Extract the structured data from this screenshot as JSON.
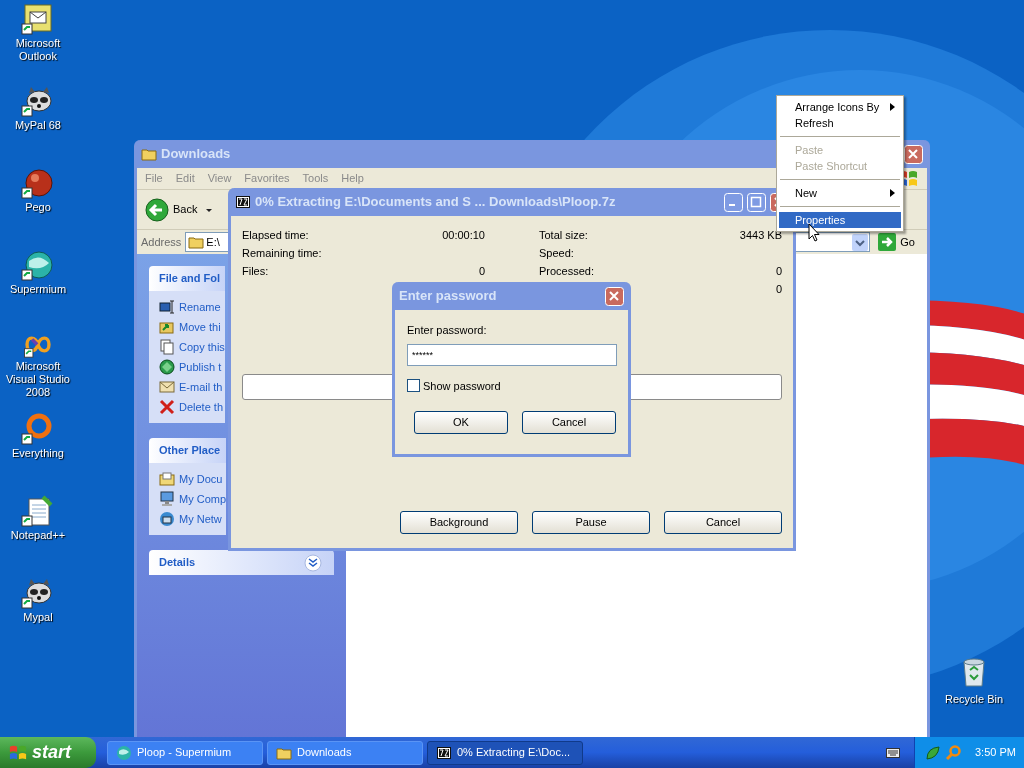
{
  "desktop_icons": [
    {
      "label": "Microsoft Outlook",
      "kind": "outlook"
    },
    {
      "label": "MyPal 68",
      "kind": "raccoon"
    },
    {
      "label": "Pego",
      "kind": "ball"
    },
    {
      "label": "Supermium",
      "kind": "globe"
    },
    {
      "label": "Microsoft Visual Studio 2008",
      "kind": "vs"
    },
    {
      "label": "Everything",
      "kind": "ring"
    },
    {
      "label": "Notepad++",
      "kind": "notepad"
    },
    {
      "label": "Mypal",
      "kind": "raccoon"
    }
  ],
  "recycle_bin": {
    "label": "Recycle Bin"
  },
  "explorer": {
    "title": "Downloads",
    "menu": [
      "File",
      "Edit",
      "View",
      "Favorites",
      "Tools",
      "Help"
    ],
    "back_label": "Back",
    "address_label": "Address",
    "address_value": "E:\\",
    "go_label": "Go",
    "panels": [
      {
        "title": "File and Fol",
        "items": [
          {
            "label": "Rename",
            "kind": "rename"
          },
          {
            "label": "Move thi",
            "kind": "move"
          },
          {
            "label": "Copy this",
            "kind": "copy"
          },
          {
            "label": "Publish t",
            "kind": "publish"
          },
          {
            "label": "E-mail th",
            "kind": "email"
          },
          {
            "label": "Delete th",
            "kind": "delete"
          }
        ]
      },
      {
        "title": "Other Place",
        "items": [
          {
            "label": "My Docu",
            "kind": "documents"
          },
          {
            "label": "My Comp",
            "kind": "computer"
          },
          {
            "label": "My Netw",
            "kind": "network"
          }
        ]
      },
      {
        "title": "Details"
      }
    ]
  },
  "extract_window": {
    "title": "0% Extracting E:\\Documents and S ... Downloads\\Ploop.7z",
    "stats_left": [
      {
        "label": "Elapsed time:",
        "value": "00:00:10"
      },
      {
        "label": "Remaining time:"
      },
      {
        "label": "Files:",
        "value": "0"
      }
    ],
    "stats_right": [
      {
        "label": "Total size:",
        "value": "3443 KB"
      },
      {
        "label": "Speed:"
      },
      {
        "label": "Processed:",
        "value": "0"
      },
      {
        "value": "0"
      }
    ],
    "progress": {
      "level": 0
    },
    "buttons": [
      "Background",
      "Pause",
      "Cancel"
    ]
  },
  "password_dialog": {
    "title": "Enter password",
    "label": "Enter password:",
    "value": "******",
    "show_password": {
      "label": "Show password",
      "checked": false
    },
    "buttons": [
      "OK",
      "Cancel"
    ]
  },
  "context_menu": [
    {
      "kind": "item",
      "label": "Arrange Icons By",
      "submenu": true,
      "disabled": false,
      "selected": false
    },
    {
      "kind": "item",
      "label": "Refresh",
      "submenu": false,
      "disabled": false,
      "selected": false
    },
    {
      "kind": "separator"
    },
    {
      "kind": "item",
      "label": "Paste",
      "submenu": false,
      "disabled": true,
      "selected": false
    },
    {
      "kind": "item",
      "label": "Paste Shortcut",
      "submenu": false,
      "disabled": true,
      "selected": false
    },
    {
      "kind": "separator"
    },
    {
      "kind": "item",
      "label": "New",
      "submenu": true,
      "disabled": false,
      "selected": false
    },
    {
      "kind": "separator"
    },
    {
      "kind": "item",
      "label": "Properties",
      "submenu": false,
      "disabled": false,
      "selected": true
    }
  ],
  "taskbar": {
    "start": "start",
    "tasks": [
      {
        "label": "Ploop - Supermium",
        "kind": "globe",
        "selected": false
      },
      {
        "label": "Downloads",
        "kind": "folder",
        "selected": false
      },
      {
        "label": "0% Extracting E:\\Doc...",
        "kind": "sevenzip",
        "selected": true
      }
    ],
    "clock": "3:50 PM"
  }
}
